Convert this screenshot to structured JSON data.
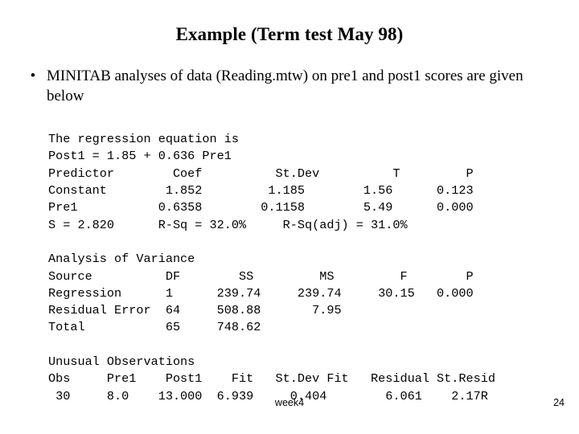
{
  "slide": {
    "title": "Example (Term test May 98)",
    "bullet": {
      "marker": "•",
      "text": "MINITAB analyses of data (Reading.mtw) on pre1 and post1 scores are given below"
    },
    "output": {
      "lines": [
        "The regression equation is",
        "Post1 = 1.85 + 0.636 Pre1",
        "Predictor        Coef          St.Dev          T         P",
        "Constant        1.852         1.185        1.56      0.123",
        "Pre1           0.6358        0.1158        5.49      0.000",
        "S = 2.820      R-Sq = 32.0%     R-Sq(adj) = 31.0%",
        "",
        "Analysis of Variance",
        "Source          DF        SS         MS         F        P",
        "Regression      1      239.74     239.74     30.15   0.000",
        "Residual Error  64     508.88       7.95",
        "Total           65     748.62",
        "",
        "Unusual Observations",
        "Obs     Pre1    Post1    Fit   St.Dev Fit   Residual St.Resid",
        " 30     8.0    13.000  6.939     0.404        6.061    2.17R"
      ]
    },
    "footer": {
      "center": "week4",
      "page": "24"
    }
  }
}
